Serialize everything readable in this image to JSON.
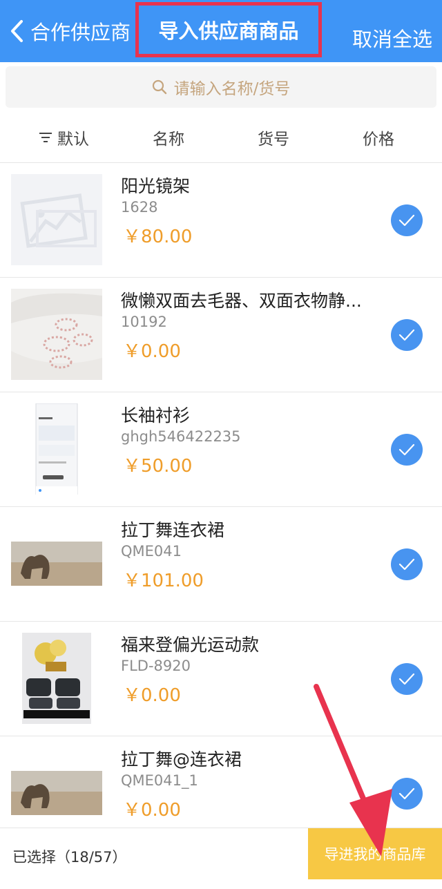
{
  "nav": {
    "back_label": "合作供应商",
    "title": "导入供应商商品",
    "cancel_all": "取消全选"
  },
  "search": {
    "placeholder": "请输入名称/货号"
  },
  "sort": {
    "default": "默认",
    "name": "名称",
    "code": "货号",
    "price": "价格"
  },
  "products": [
    {
      "name": "阳光镜架",
      "code": "1628",
      "price": "￥80.00",
      "checked": true
    },
    {
      "name": "微懒双面去毛器、双面衣物静...",
      "code": "10192",
      "price": "￥0.00",
      "checked": true
    },
    {
      "name": "长袖衬衫",
      "code": "ghgh546422235",
      "price": "￥50.00",
      "checked": true
    },
    {
      "name": "拉丁舞连衣裙",
      "code": "QME041",
      "price": "￥101.00",
      "checked": true
    },
    {
      "name": "福来登偏光运动款",
      "code": "FLD-8920",
      "price": "￥0.00",
      "checked": true
    },
    {
      "name": "拉丁舞@连衣裙",
      "code": "QME041_1",
      "price": "￥0.00",
      "checked": true
    }
  ],
  "footer": {
    "selected_text": "已选择（18/57）",
    "import_button": "导进我的商品库"
  },
  "colors": {
    "nav_bg": "#3f95f6",
    "price": "#ef9d2a",
    "check": "#4894f0",
    "import_btn": "#f7c844",
    "annotation": "#e8334e"
  }
}
